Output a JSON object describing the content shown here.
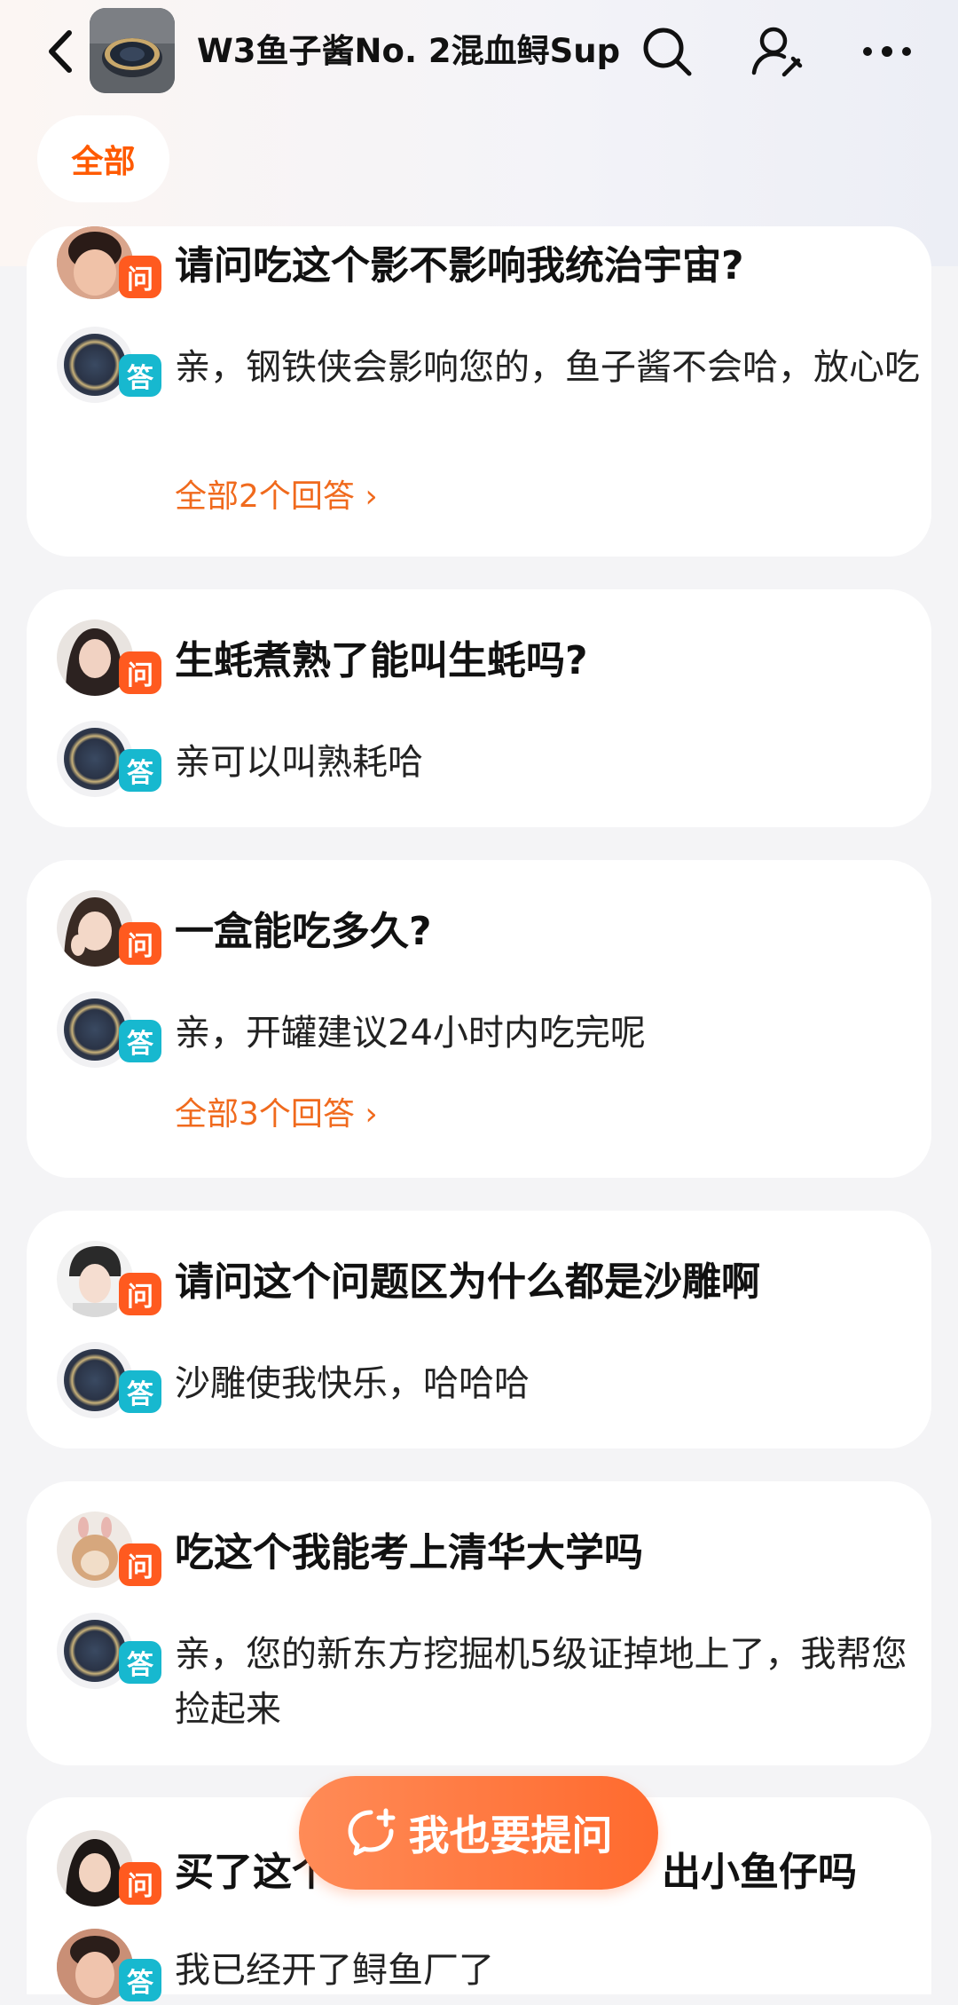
{
  "header": {
    "title": "W3鱼子酱No. 2混血鲟Sup…"
  },
  "filter": {
    "active_label": "全部"
  },
  "qa_items": [
    {
      "question": "请问吃这个影不影响我统治宇宙?",
      "answer": "亲，钢铁侠会影响您的，鱼子酱不会哈，放心吃",
      "more": "全部2个回答 ›"
    },
    {
      "question": "生蚝煮熟了能叫生蚝吗?",
      "answer": "亲可以叫熟耗哈"
    },
    {
      "question": "一盒能吃多久?",
      "answer": "亲，开罐建议24小时内吃完呢",
      "more": "全部3个回答 ›"
    },
    {
      "question": "请问这个问题区为什么都是沙雕啊",
      "answer": "沙雕使我快乐，哈哈哈"
    },
    {
      "question": "吃这个我能考上清华大学吗",
      "answer": "亲，您的新东方挖掘机5级证掉地上了，我帮您捡起来"
    },
    {
      "question": "买了这个",
      "question_tail": "出小鱼仔吗",
      "answer": "我已经开了鲟鱼厂了"
    }
  ],
  "badges": {
    "question": "问",
    "answer": "答"
  },
  "ask_button": {
    "label": "我也要提问"
  },
  "colors": {
    "accent_orange": "#ff5a00",
    "question_badge": "#ff5a1f",
    "answer_badge": "#17b8cf",
    "link_orange": "#f06a1d"
  },
  "icons": {
    "back": "chevron-left-icon",
    "search": "search-icon",
    "user_edit": "user-edit-icon",
    "more": "more-dots-icon",
    "ask": "chat-bubble-add-icon"
  }
}
